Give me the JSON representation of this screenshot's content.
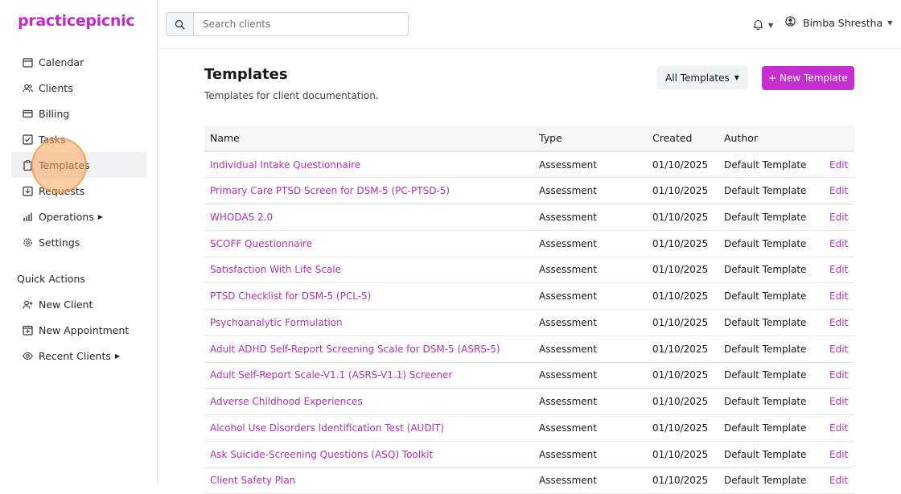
{
  "app": {
    "logo": "practicepicnic"
  },
  "sidebar": {
    "items": [
      {
        "label": "Calendar",
        "icon": "calendar-icon"
      },
      {
        "label": "Clients",
        "icon": "users-icon"
      },
      {
        "label": "Billing",
        "icon": "credit-card-icon"
      },
      {
        "label": "Tasks",
        "icon": "checkbox-icon"
      },
      {
        "label": "Templates",
        "icon": "clipboard-icon"
      },
      {
        "label": "Requests",
        "icon": "inbox-icon"
      },
      {
        "label": "Operations",
        "icon": "bar-chart-icon"
      },
      {
        "label": "Settings",
        "icon": "gear-icon"
      }
    ],
    "quick_actions_title": "Quick Actions",
    "quick_actions": [
      {
        "label": "New Client",
        "icon": "user-plus-icon"
      },
      {
        "label": "New Appointment",
        "icon": "calendar-plus-icon"
      },
      {
        "label": "Recent Clients",
        "icon": "eye-icon"
      }
    ]
  },
  "topbar": {
    "search_placeholder": "Search clients",
    "user_name": "Bimba Shrestha"
  },
  "page": {
    "title": "Templates",
    "subtitle": "Templates for client documentation.",
    "filter_label": "All Templates",
    "new_button_label": "+ New Template"
  },
  "table": {
    "headers": [
      "Name",
      "Type",
      "Created",
      "Author",
      ""
    ],
    "rows": [
      {
        "name": "Individual Intake Questionnaire",
        "type": "Assessment",
        "created": "01/10/2025",
        "author": "Default Template",
        "action": "Edit"
      },
      {
        "name": "Primary Care PTSD Screen for DSM-5 (PC-PTSD-5)",
        "type": "Assessment",
        "created": "01/10/2025",
        "author": "Default Template",
        "action": "Edit"
      },
      {
        "name": "WHODAS 2.0",
        "type": "Assessment",
        "created": "01/10/2025",
        "author": "Default Template",
        "action": "Edit"
      },
      {
        "name": "SCOFF Questionnaire",
        "type": "Assessment",
        "created": "01/10/2025",
        "author": "Default Template",
        "action": "Edit"
      },
      {
        "name": "Satisfaction With Life Scale",
        "type": "Assessment",
        "created": "01/10/2025",
        "author": "Default Template",
        "action": "Edit"
      },
      {
        "name": "PTSD Checklist for DSM-5 (PCL-5)",
        "type": "Assessment",
        "created": "01/10/2025",
        "author": "Default Template",
        "action": "Edit"
      },
      {
        "name": "Psychoanalytic Formulation",
        "type": "Assessment",
        "created": "01/10/2025",
        "author": "Default Template",
        "action": "Edit"
      },
      {
        "name": "Adult ADHD Self-Report Screening Scale for DSM-5 (ASRS-5)",
        "type": "Assessment",
        "created": "01/10/2025",
        "author": "Default Template",
        "action": "Edit"
      },
      {
        "name": "Adult Self-Report Scale-V1.1 (ASRS-V1.1) Screener",
        "type": "Assessment",
        "created": "01/10/2025",
        "author": "Default Template",
        "action": "Edit"
      },
      {
        "name": "Adverse Childhood Experiences",
        "type": "Assessment",
        "created": "01/10/2025",
        "author": "Default Template",
        "action": "Edit"
      },
      {
        "name": "Alcohol Use Disorders Identification Test (AUDIT)",
        "type": "Assessment",
        "created": "01/10/2025",
        "author": "Default Template",
        "action": "Edit"
      },
      {
        "name": "Ask Suicide-Screening Questions (ASQ) Toolkit",
        "type": "Assessment",
        "created": "01/10/2025",
        "author": "Default Template",
        "action": "Edit"
      },
      {
        "name": "Client Safety Plan",
        "type": "Assessment",
        "created": "01/10/2025",
        "author": "Default Template",
        "action": "Edit"
      }
    ]
  },
  "colors": {
    "brand": "#c227c9",
    "link": "#b52fb9",
    "primary_button": "#c52fd0"
  }
}
